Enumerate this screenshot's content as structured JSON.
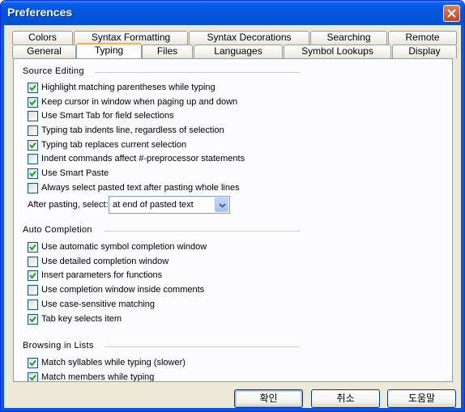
{
  "window": {
    "title": "Preferences"
  },
  "tabs": {
    "row1": [
      "Colors",
      "Syntax Formatting",
      "Syntax Decorations",
      "Searching",
      "Remote"
    ],
    "row2": [
      "General",
      "Typing",
      "Files",
      "Languages",
      "Symbol Lookups",
      "Display"
    ],
    "active": "Typing"
  },
  "source_editing": {
    "heading": "Source Editing",
    "options": [
      {
        "label": "Highlight matching parentheses while typing",
        "checked": true
      },
      {
        "label": "Keep cursor in window when paging up and down",
        "checked": true
      },
      {
        "label": "Use Smart Tab for field selections",
        "checked": false
      },
      {
        "label": "Typing tab indents line, regardless of selection",
        "checked": false
      },
      {
        "label": "Typing tab replaces current selection",
        "checked": true
      },
      {
        "label": "Indent commands affect #-preprocessor statements",
        "checked": false
      },
      {
        "label": "Use Smart Paste",
        "checked": true
      },
      {
        "label": "Always select pasted text after pasting whole lines",
        "checked": false
      }
    ],
    "after_pasting_label": "After pasting, select:",
    "after_pasting_value": "at end of pasted text"
  },
  "auto_completion": {
    "heading": "Auto Completion",
    "options": [
      {
        "label": "Use automatic symbol completion window",
        "checked": true
      },
      {
        "label": "Use detailed completion window",
        "checked": false
      },
      {
        "label": "Insert parameters for functions",
        "checked": true
      },
      {
        "label": "Use completion window inside comments",
        "checked": false
      },
      {
        "label": "Use case-sensitive matching",
        "checked": false
      },
      {
        "label": "Tab key selects item",
        "checked": true
      }
    ]
  },
  "browsing_in_lists": {
    "heading": "Browsing in Lists",
    "options": [
      {
        "label": "Match syllables while typing (slower)",
        "checked": true
      },
      {
        "label": "Match members while typing",
        "checked": true
      }
    ]
  },
  "buttons": {
    "ok": "확인",
    "cancel": "취소",
    "help": "도움말"
  },
  "colors": {
    "titlebar": "#0454e0",
    "dialog_bg": "#ece9d8",
    "tab_highlight": "#f7b34a"
  }
}
